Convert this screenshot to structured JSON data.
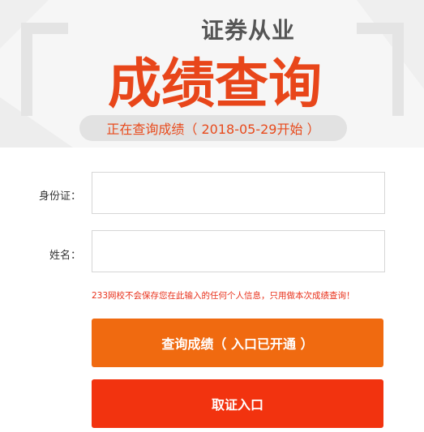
{
  "header": {
    "subtitle": "证券从业",
    "title": "成绩查询",
    "status": "正在查询成绩（ 2018-05-29开始 ）"
  },
  "form": {
    "id_label": "身份证：",
    "id_value": "",
    "name_label": "姓名：",
    "name_value": "",
    "notice": "233网校不会保存您在此输入的任何个人信息，只用做本次成绩查询！"
  },
  "buttons": {
    "query_label": "查询成绩（ 入口已开通 ）",
    "cert_label": "取证入口"
  },
  "colors": {
    "accent": "#e8461a",
    "query_button": "#f06a10",
    "cert_button": "#f2330f",
    "notice_text": "#e8301a"
  }
}
